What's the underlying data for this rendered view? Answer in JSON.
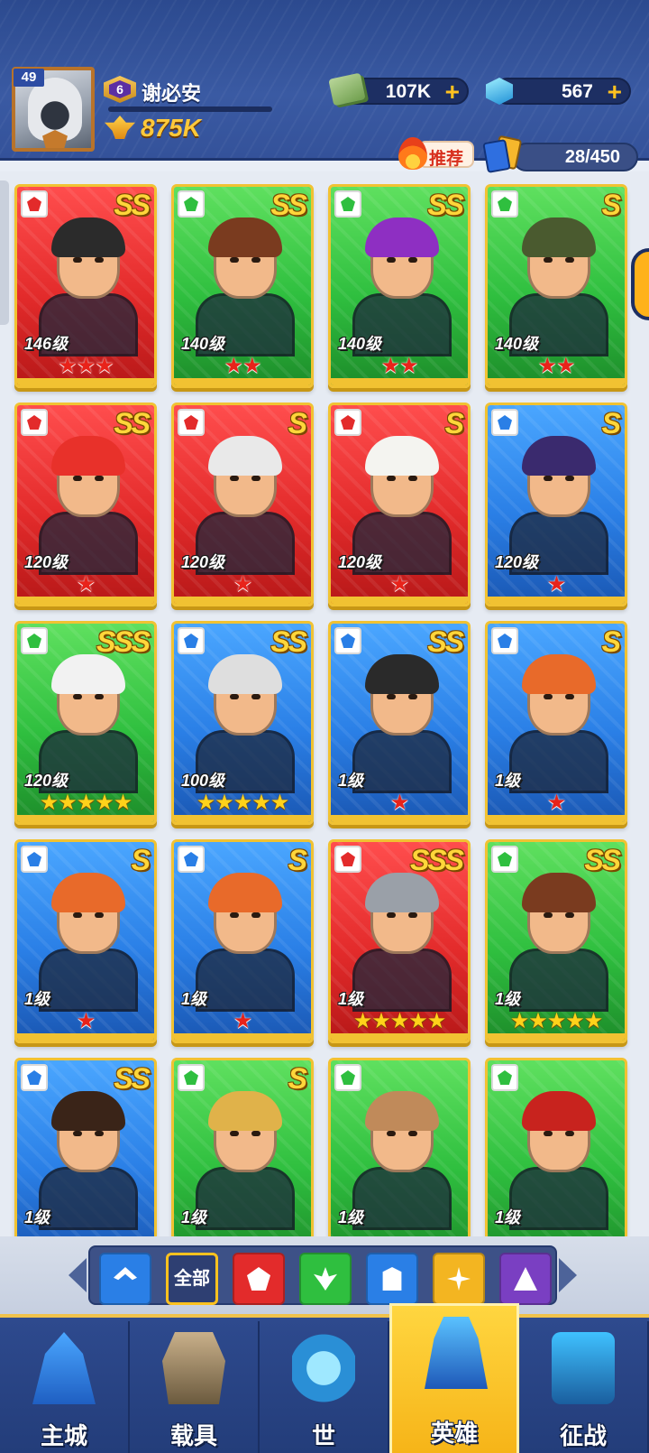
{
  "player": {
    "level": "49",
    "vip": "6",
    "name": "谢必安",
    "power": "875K"
  },
  "resources": {
    "cash": "107K",
    "gems": "567",
    "plus_symbol": "+"
  },
  "toolbar": {
    "recommend_label": "推荐",
    "hero_count": "28/450",
    "filter_all_label": "全部"
  },
  "heroes": [
    {
      "rank": "SS",
      "level": "146级",
      "stars": "★★★",
      "color": "red",
      "hair": "#2b2b2b"
    },
    {
      "rank": "SS",
      "level": "140级",
      "stars": "★★",
      "color": "green",
      "hair": "#7a3b1f"
    },
    {
      "rank": "SS",
      "level": "140级",
      "stars": "★★",
      "color": "green",
      "hair": "#8e2fc2"
    },
    {
      "rank": "S",
      "level": "140级",
      "stars": "★★",
      "color": "green",
      "hair": "#4a5a2f"
    },
    {
      "rank": "SS",
      "level": "120级",
      "stars": "★",
      "color": "red",
      "hair": "#e8312a"
    },
    {
      "rank": "S",
      "level": "120级",
      "stars": "★",
      "color": "red",
      "hair": "#e9e9e9"
    },
    {
      "rank": "S",
      "level": "120级",
      "stars": "★",
      "color": "red",
      "hair": "#f4f4f0"
    },
    {
      "rank": "S",
      "level": "120级",
      "stars": "★",
      "color": "blue",
      "hair": "#3a2a6e"
    },
    {
      "rank": "SSS",
      "level": "120级",
      "stars": "★★★★★",
      "color": "green",
      "hair": "#f2f2f2"
    },
    {
      "rank": "SS",
      "level": "100级",
      "stars": "★★★★★",
      "color": "blue",
      "hair": "#dedede"
    },
    {
      "rank": "SS",
      "level": "1级",
      "stars": "★",
      "color": "blue",
      "hair": "#2a2a2a"
    },
    {
      "rank": "S",
      "level": "1级",
      "stars": "★",
      "color": "blue",
      "hair": "#e86a2a"
    },
    {
      "rank": "S",
      "level": "1级",
      "stars": "★",
      "color": "blue",
      "hair": "#e86a2a"
    },
    {
      "rank": "S",
      "level": "1级",
      "stars": "★",
      "color": "blue",
      "hair": "#e86a2a"
    },
    {
      "rank": "SSS",
      "level": "1级",
      "stars": "★★★★★",
      "color": "red",
      "hair": "#9aa0a8"
    },
    {
      "rank": "SS",
      "level": "1级",
      "stars": "★★★★★",
      "color": "green",
      "hair": "#7a3b1f"
    },
    {
      "rank": "SS",
      "level": "1级",
      "stars": "",
      "color": "blue",
      "hair": "#3a2418"
    },
    {
      "rank": "S",
      "level": "1级",
      "stars": "",
      "color": "green",
      "hair": "#e0b24a"
    },
    {
      "rank": "",
      "level": "1级",
      "stars": "",
      "color": "green",
      "hair": "#c08a5a"
    },
    {
      "rank": "",
      "level": "1级",
      "stars": "",
      "color": "green",
      "hair": "#c8231e"
    }
  ],
  "filters": [
    {
      "name": "upgrade-filter-icon",
      "kind": "up"
    },
    {
      "name": "all-filter",
      "kind": "all"
    },
    {
      "name": "red-class-icon",
      "kind": "red"
    },
    {
      "name": "green-class-icon",
      "kind": "green"
    },
    {
      "name": "blue-class-icon",
      "kind": "blue"
    },
    {
      "name": "gold-class-icon",
      "kind": "gold"
    },
    {
      "name": "purple-class-icon",
      "kind": "purple"
    }
  ],
  "nav": {
    "items": [
      {
        "label": "主城",
        "icon": "city-icon"
      },
      {
        "label": "载具",
        "icon": "vehicle-icon"
      },
      {
        "label": "世",
        "icon": "world-icon"
      },
      {
        "label": "英雄",
        "icon": "hero-icon"
      },
      {
        "label": "征战",
        "icon": "campaign-icon"
      }
    ],
    "active_index": 3
  }
}
